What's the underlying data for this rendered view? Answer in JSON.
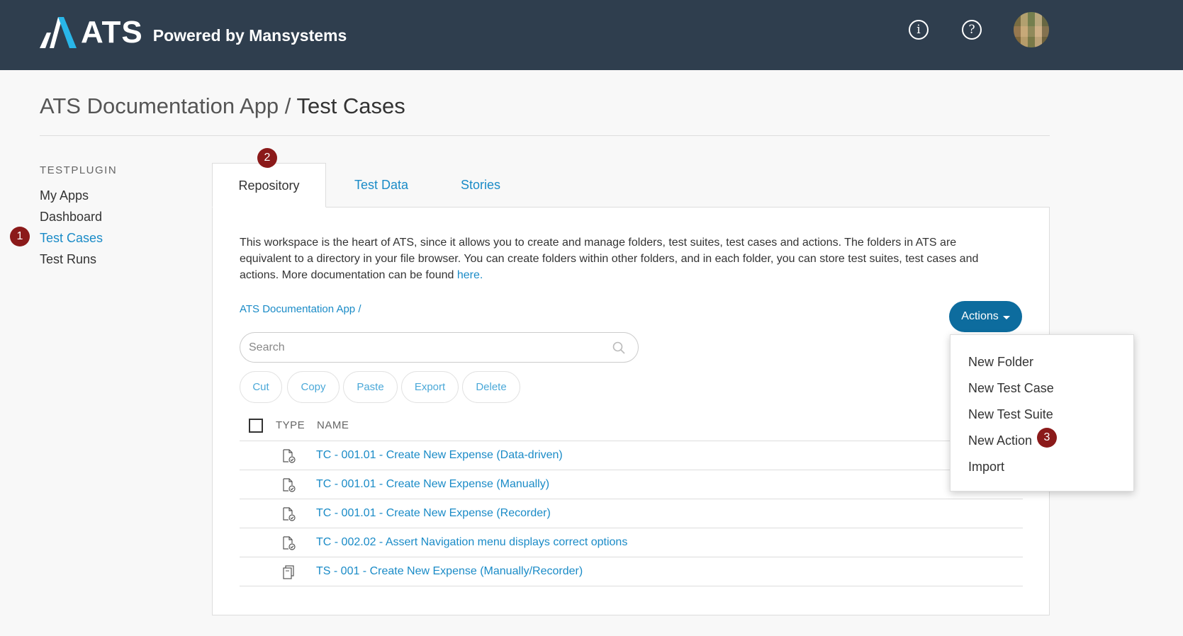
{
  "header": {
    "logo_text": "ATS",
    "tagline": "Powered by Mansystems",
    "info_glyph": "i",
    "help_glyph": "?"
  },
  "page": {
    "title_app": "ATS Documentation App",
    "title_sep": " / ",
    "title_current": "Test Cases"
  },
  "sidebar": {
    "heading": "TESTPLUGIN",
    "items": [
      {
        "label": "My Apps"
      },
      {
        "label": "Dashboard"
      },
      {
        "label": "Test Cases"
      },
      {
        "label": "Test Runs"
      }
    ]
  },
  "badges": [
    "1",
    "2",
    "3"
  ],
  "tabs": [
    {
      "label": "Repository"
    },
    {
      "label": "Test Data"
    },
    {
      "label": "Stories"
    }
  ],
  "description": {
    "text": "This workspace is the heart of ATS, since it allows you to create and manage folders, test suites, test cases and actions. The folders in ATS are equivalent to a directory in your file browser. You can create folders within other folders, and in each folder, you can store test suites, test cases and actions. More documentation can be found ",
    "link": "here."
  },
  "breadcrumb": "ATS Documentation App /",
  "actions": {
    "label": "Actions",
    "menu": [
      {
        "label": "New Folder"
      },
      {
        "label": "New Test Case"
      },
      {
        "label": "New Test Suite"
      },
      {
        "label": "New Action"
      },
      {
        "label": "Import"
      }
    ]
  },
  "search": {
    "placeholder": "Search",
    "value": ""
  },
  "toolbar": {
    "cut": "Cut",
    "copy": "Copy",
    "paste": "Paste",
    "export": "Export",
    "delete": "Delete"
  },
  "table": {
    "headers": {
      "type": "TYPE",
      "name": "NAME"
    },
    "rows": [
      {
        "type_icon": "test-case-icon",
        "name": "TC - 001.01 - Create New Expense (Data-driven)"
      },
      {
        "type_icon": "test-case-icon",
        "name": "TC - 001.01 - Create New Expense (Manually)"
      },
      {
        "type_icon": "test-case-icon",
        "name": "TC - 001.01 - Create New Expense (Recorder)"
      },
      {
        "type_icon": "test-case-icon",
        "name": "TC - 002.02 - Assert Navigation menu displays correct options"
      },
      {
        "type_icon": "test-suite-icon",
        "name": "TS - 001 - Create New Expense (Manually/Recorder)"
      }
    ]
  },
  "colors": {
    "header_bg": "#2f3e4e",
    "accent": "#1a8bc7",
    "button": "#0d6c9e",
    "badge": "#8b1a1a"
  }
}
